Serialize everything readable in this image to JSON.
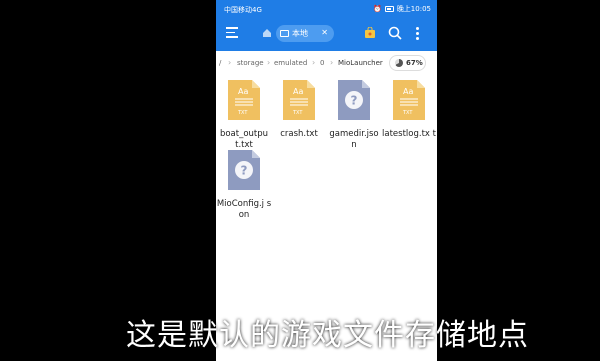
{
  "statusbar": {
    "carrier": "中国移动4G",
    "signal": "ıll ≋",
    "clock": "晚上10:05"
  },
  "toolbar": {
    "tab_label": "本地",
    "tab_close": "✕"
  },
  "breadcrumb": {
    "items": [
      "/",
      "storage",
      "emulated",
      "0",
      "MioLauncher"
    ],
    "separator": "›",
    "usage": "67%"
  },
  "files": [
    {
      "name": "boat_output.txt",
      "type": "txt",
      "display": "boat_outpu t.txt"
    },
    {
      "name": "crash.txt",
      "type": "txt",
      "display": "crash.txt"
    },
    {
      "name": "gamedir.json",
      "type": "unknown",
      "display": "gamedir.jso n"
    },
    {
      "name": "latestlog.txt",
      "type": "txt",
      "display": "latestlog.tx t"
    },
    {
      "name": "MioConfig.json",
      "type": "unknown",
      "display": "MioConfig.j son"
    }
  ],
  "txt_icon": {
    "label": "Aa",
    "tag": "TXT"
  },
  "colors": {
    "toolbar": "#1f7de6",
    "txt_icon": "#f0c060",
    "unknown_icon": "#8e9bc0"
  },
  "subtitle": "这是默认的游戏文件存储地点"
}
